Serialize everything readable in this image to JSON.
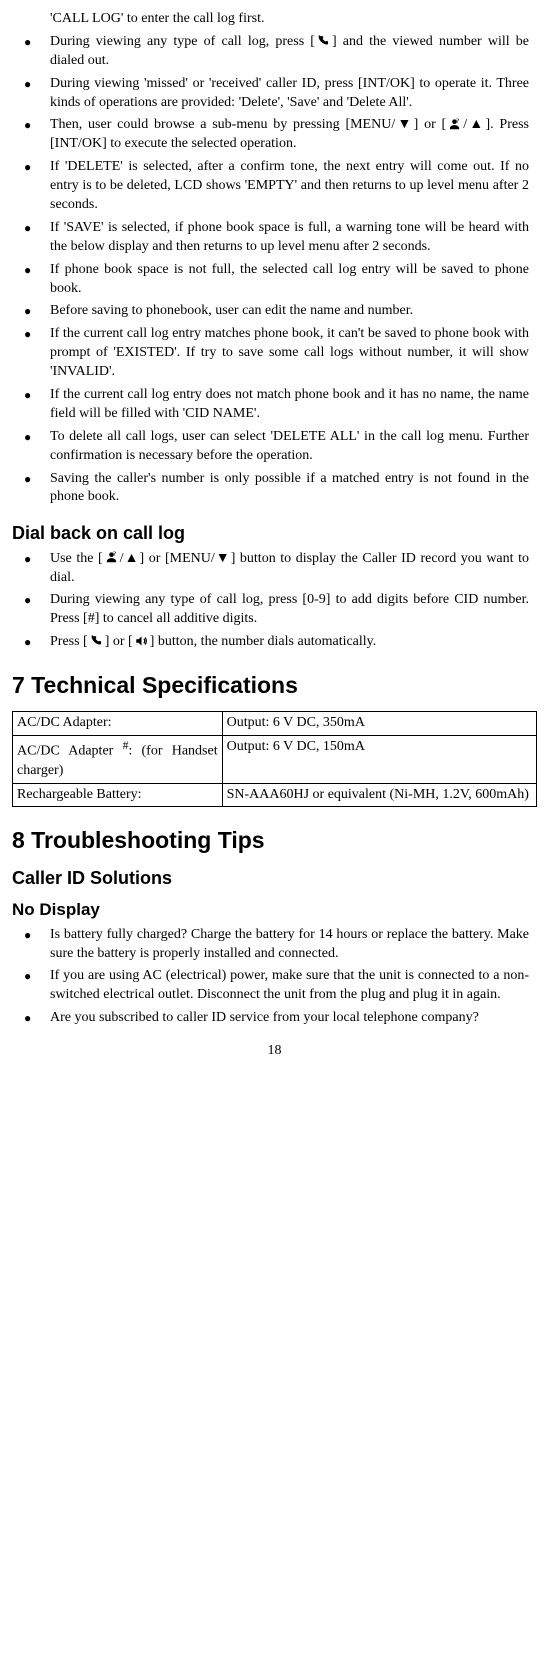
{
  "intro": "'CALL LOG' to enter the call log first.",
  "list1": [
    "During viewing any type of call log, press [{handset}] and the viewed number will be dialed out.",
    "During viewing 'missed' or 'received' caller ID, press [INT/OK] to operate it. Three kinds of operations are provided: 'Delete', 'Save' and 'Delete All'.",
    "Then, user could browse a sub-menu by pressing [MENU/▼] or [{person}/▲]. Press [INT/OK] to execute the selected operation.",
    "If 'DELETE' is selected, after a confirm tone, the next entry will come out. If no entry is to be deleted, LCD shows 'EMPTY' and then returns to up level menu after 2 seconds.",
    "If 'SAVE' is selected, if phone book space is full, a warning tone will be heard with the below display and then returns to up level menu after 2 seconds.",
    "If phone book space is not full, the selected call log entry will be saved to phone book.",
    "Before saving to phonebook, user can edit the name and number.",
    "If the current call log entry matches phone book, it can't be saved to phone book with prompt of 'EXISTED'. If try to save some call logs without number, it will show 'INVALID'.",
    "If the current call log entry does not match phone book and it has no name, the name field will be filled with 'CID NAME'.",
    "To delete all call logs, user can select 'DELETE ALL' in the call log menu. Further confirmation is necessary before the operation.",
    "Saving the caller's number is only possible if a matched entry is not found in the phone book."
  ],
  "dialback_heading": "Dial back on call log",
  "list2": [
    "Use the [{person}/▲] or [MENU/▼] button to display the Caller ID record you want to dial.",
    "During viewing any type of call log, press [0-9] to add digits before CID number. Press [#] to cancel all additive digits.",
    "Press [{handset}] or [{speaker}] button, the number dials automatically."
  ],
  "tech_heading": "7   Technical Specifications",
  "spec_rows": [
    {
      "left": "AC/DC Adapter:",
      "right": "Output: 6 V DC, 350mA"
    },
    {
      "left": "AC/DC Adapter <sup>#</sup>: (for Handset charger)",
      "right": "Output: 6 V DC, 150mA"
    },
    {
      "left": "Rechargeable Battery:",
      "right": "SN-AAA60HJ or equivalent (Ni-MH, 1.2V, 600mAh)"
    }
  ],
  "trouble_heading": "8   Troubleshooting Tips",
  "callerid_heading": "Caller ID Solutions",
  "nodisplay_heading": "No Display",
  "list3": [
    "Is battery fully charged? Charge the battery for 14 hours or replace the battery. Make sure the battery is properly installed and connected.",
    "If you are using AC (electrical) power, make sure that the unit is connected to a non-switched electrical outlet. Disconnect the unit from the plug and plug it in again.",
    "Are you subscribed to caller ID service from your local telephone company?"
  ],
  "pagenum": "18",
  "icons": {
    "handset_svg": "<svg class='icon' viewBox='0 0 24 24'><path fill='#000' d='M6 2c-1 0-2 1-2 2 0 8 8 16 16 16 1 0 2-1 2-2v-3c0-1-1-2-2-2l-3 1c-1 0-2-1-3-2s-2-2-2-3l1-3c0-1-1-2-2-2H6z' transform='scale(0.9)'/></svg>",
    "person_svg": "<svg class='icon' viewBox='0 0 24 24'><path fill='#000' d='M12 12a4 4 0 100-8 4 4 0 000 8zm-8 8c0-4 4-6 8-6s8 2 8 6v1H4v-1z'/><text x='15' y='9' font-size='10' font-weight='bold'>?</text></svg>",
    "speaker_svg": "<svg class='icon' viewBox='0 0 24 24'><path fill='#000' d='M3 9v6h4l5 5V4L7 9H3z'/><path fill='none' stroke='#000' stroke-width='2' d='M16 8c2 2 2 6 0 8M18 6c3 3 3 9 0 12'/></svg>"
  }
}
